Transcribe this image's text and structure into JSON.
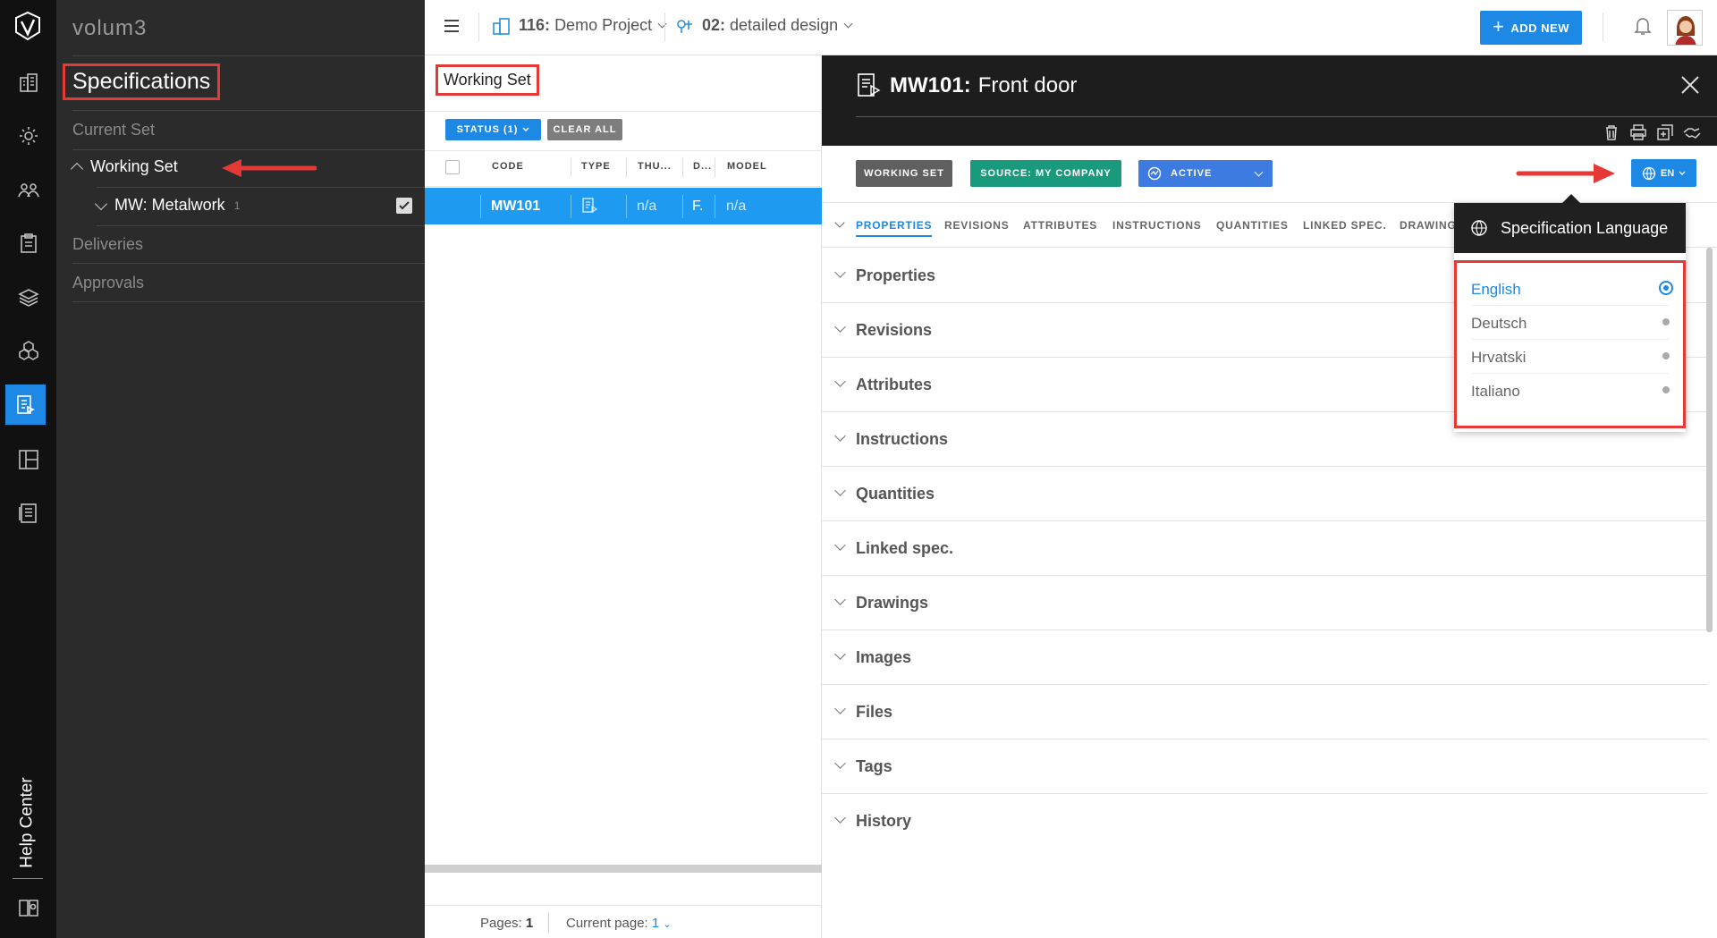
{
  "app": {
    "brand": "volum3",
    "help_center": "Help Center"
  },
  "nav": {
    "title": "Specifications",
    "items": [
      "Current Set",
      "Working Set",
      "Deliveries",
      "Approvals"
    ],
    "working_set_child": {
      "label": "MW: Metalwork",
      "count": "1",
      "checked": true
    }
  },
  "topbar": {
    "project_num": "116:",
    "project_name": "Demo Project",
    "phase_num": "02:",
    "phase_name": "detailed design",
    "add_new": "ADD NEW"
  },
  "list": {
    "title": "Working Set",
    "status_filter": "STATUS (1)",
    "clear_all": "CLEAR ALL",
    "columns": [
      "CODE",
      "TYPE",
      "THU...",
      "D...",
      "MODEL"
    ],
    "rows": [
      {
        "code": "MW101",
        "thumb": "n/a",
        "d": "F.",
        "model": "n/a"
      }
    ],
    "pages_label": "Pages:",
    "pages_value": "1",
    "current_page_label": "Current page:",
    "current_page_value": "1"
  },
  "detail": {
    "code": "MW101:",
    "name": "Front door",
    "tags": {
      "set": "WORKING SET",
      "source": "SOURCE: MY COMPANY",
      "status": "ACTIVE"
    },
    "lang_button": "EN",
    "tabs": [
      "PROPERTIES",
      "REVISIONS",
      "ATTRIBUTES",
      "INSTRUCTIONS",
      "QUANTITIES",
      "LINKED SPEC.",
      "DRAWING"
    ],
    "sections": [
      "Properties",
      "Revisions",
      "Attributes",
      "Instructions",
      "Quantities",
      "Linked spec.",
      "Drawings",
      "Images",
      "Files",
      "Tags",
      "History"
    ]
  },
  "language_popup": {
    "title": "Specification Language",
    "options": [
      "English",
      "Deutsch",
      "Hrvatski",
      "Italiano"
    ],
    "selected": "English"
  },
  "colors": {
    "accent": "#1e88e5",
    "highlight": "#e53935",
    "source_tag": "#1a9a7d",
    "dark": "#1d1d1d"
  }
}
